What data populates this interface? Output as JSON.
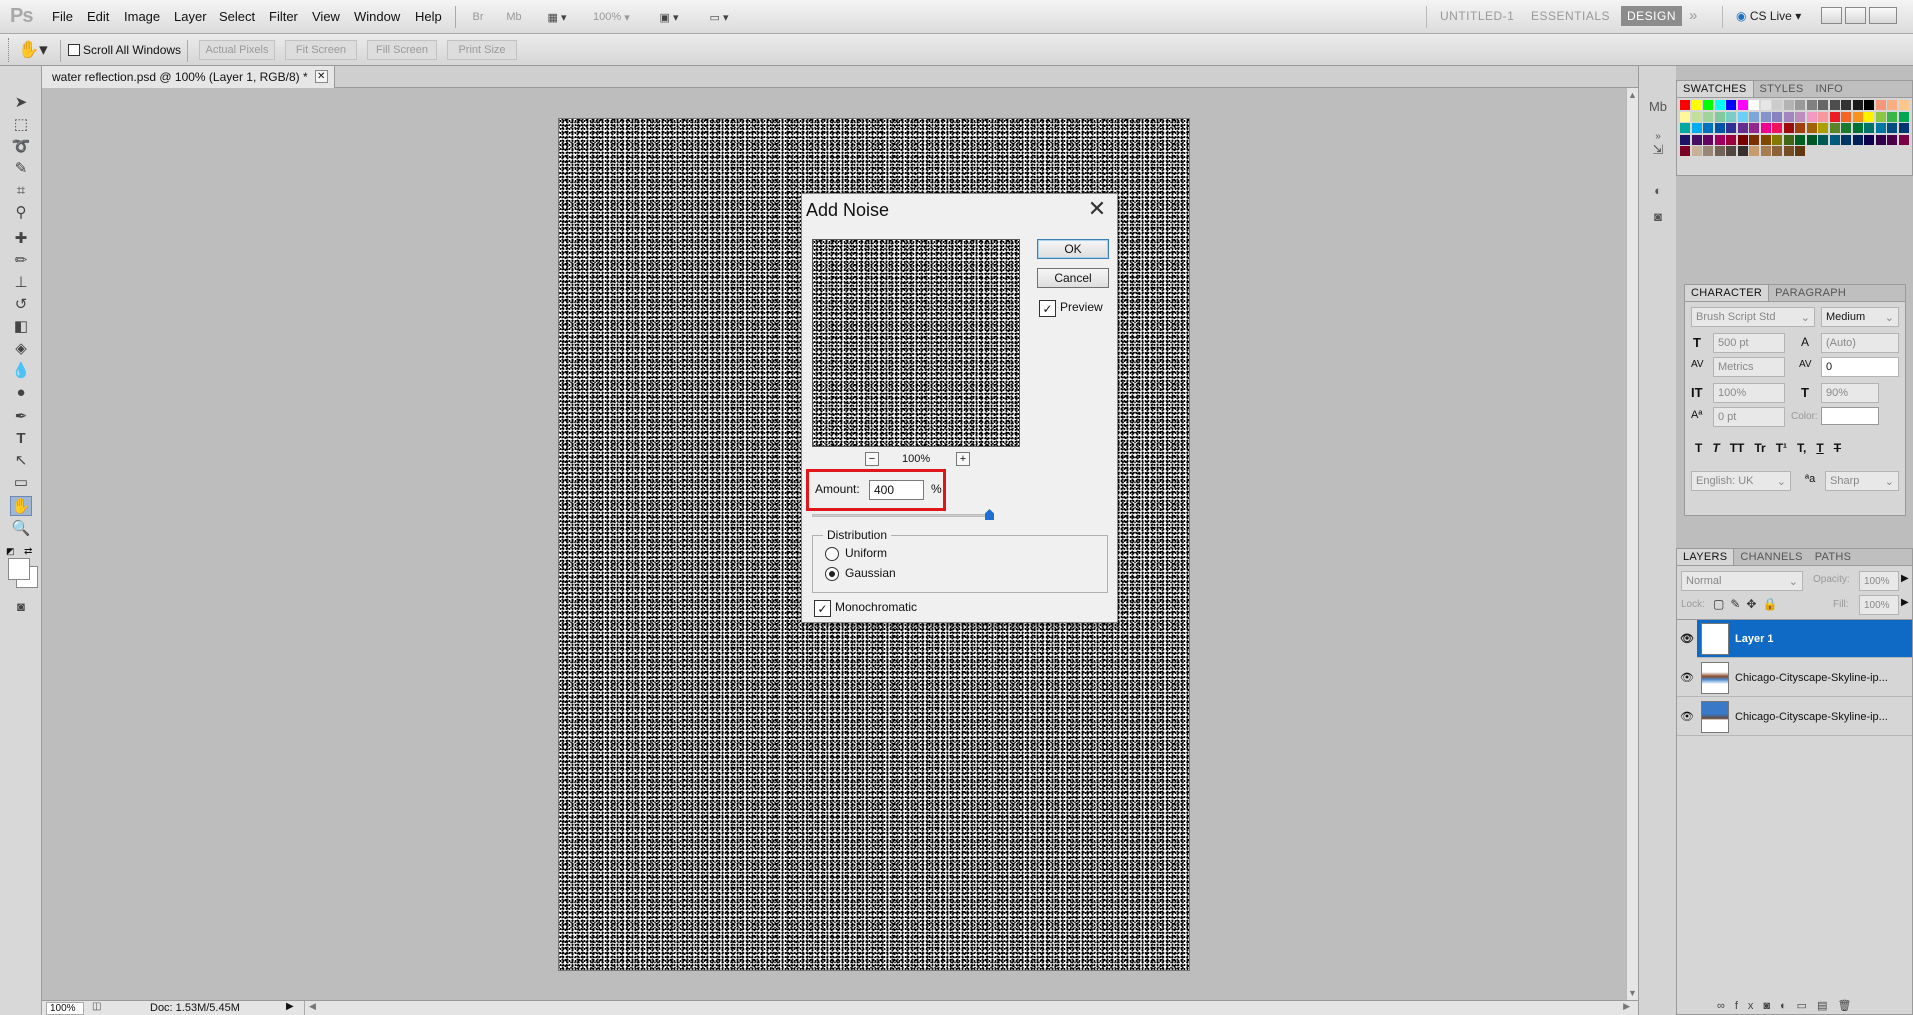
{
  "app": {
    "logo": "Ps",
    "menu": [
      "File",
      "Edit",
      "Image",
      "Layer",
      "Select",
      "Filter",
      "View",
      "Window",
      "Help"
    ],
    "zoom_field": "100%",
    "workspaces": [
      "UNTITLED-1",
      "ESSENTIALS",
      "DESIGN"
    ],
    "cslive": "CS Live"
  },
  "options_bar": {
    "scroll_all_windows": "Scroll All Windows",
    "buttons": [
      "Actual Pixels",
      "Fit Screen",
      "Fill Screen",
      "Print Size"
    ]
  },
  "document": {
    "tab_title": "water reflection.psd @ 100% (Layer 1, RGB/8) *",
    "status_zoom": "100%",
    "status_doc": "Doc: 1.53M/5.45M"
  },
  "swatches_panel": {
    "tabs": [
      "SWATCHES",
      "STYLES",
      "INFO"
    ]
  },
  "character_panel": {
    "tabs": [
      "CHARACTER",
      "PARAGRAPH"
    ],
    "font_family": "Brush Script Std",
    "font_style": "Medium",
    "font_size": "500 pt",
    "leading": "(Auto)",
    "kerning": "Metrics",
    "tracking": "0",
    "vertical_scale": "100%",
    "horizontal_scale": "90%",
    "baseline_shift": "0 pt",
    "color_label": "Color:",
    "style_buttons": [
      "T",
      "T",
      "TT",
      "Tr",
      "T¹",
      "T,",
      "T",
      "T"
    ],
    "language": "English: UK",
    "aa_label": "ªa",
    "antialias": "Sharp"
  },
  "layers_panel": {
    "tabs": [
      "LAYERS",
      "CHANNELS",
      "PATHS"
    ],
    "blend_mode": "Normal",
    "opacity_label": "Opacity:",
    "opacity": "100%",
    "lock_label": "Lock:",
    "fill_label": "Fill:",
    "fill": "100%",
    "layers": [
      {
        "name": "Layer 1",
        "selected": true
      },
      {
        "name": "Chicago-Cityscape-Skyline-ip...",
        "selected": false
      },
      {
        "name": "Chicago-Cityscape-Skyline-ip...",
        "selected": false
      }
    ]
  },
  "dialog": {
    "title": "Add Noise",
    "ok": "OK",
    "cancel": "Cancel",
    "preview_label": "Preview",
    "preview_checked": true,
    "zoom_minus": "−",
    "zoom_level": "100%",
    "zoom_plus": "+",
    "amount_label": "Amount:",
    "amount_value": "400",
    "amount_unit": "%",
    "amount_slider_fraction": 1.0,
    "distribution_label": "Distribution",
    "distribution_options": [
      "Uniform",
      "Gaussian"
    ],
    "distribution_selected": "Gaussian",
    "monochromatic_label": "Monochromatic",
    "monochromatic_checked": true,
    "highlight_color": "#e0161b"
  },
  "colors": {
    "selection_blue": "#0f6ac6",
    "design_active": "#8c8c8c"
  }
}
